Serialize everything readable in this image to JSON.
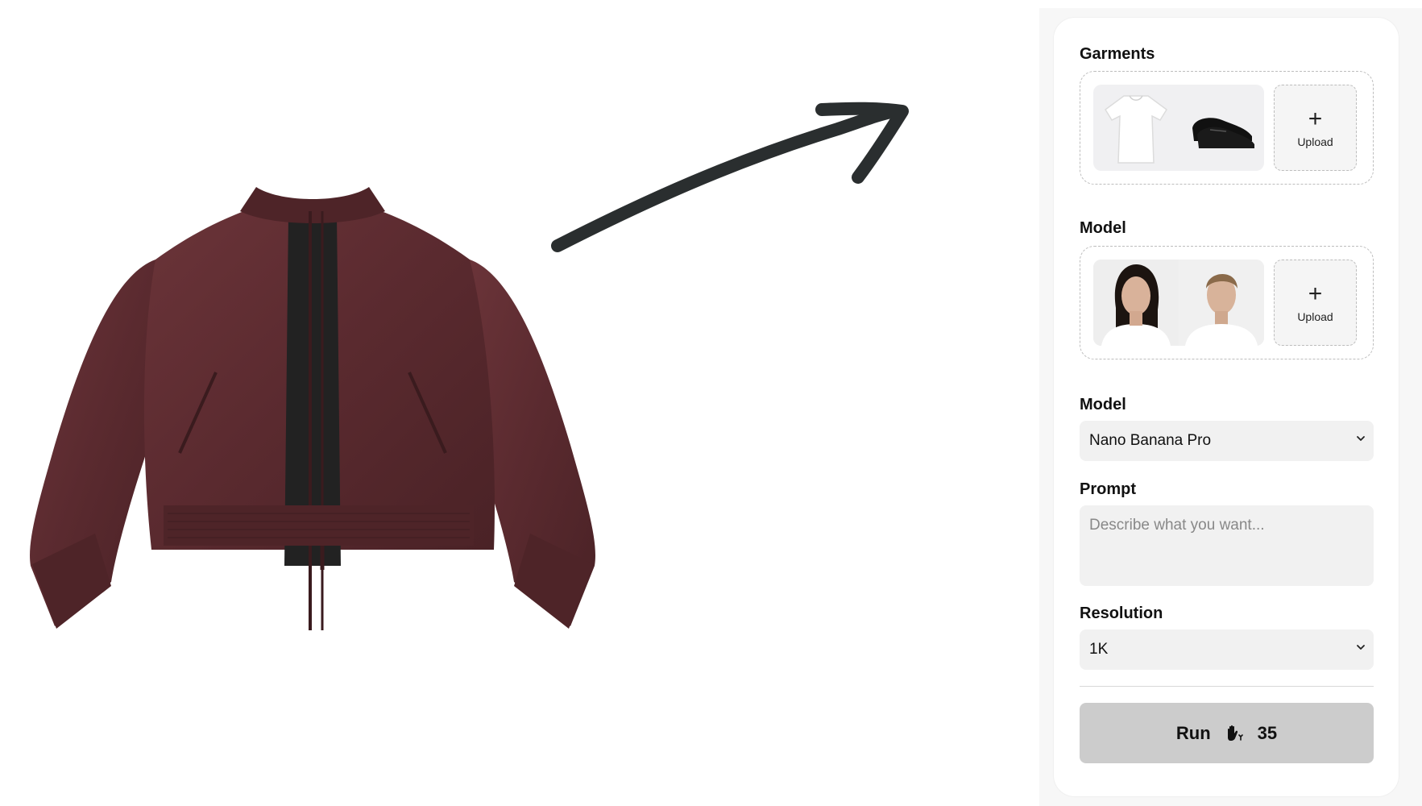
{
  "canvas": {
    "product_image": "bomber-jacket-image",
    "arrow": "hand-drawn-arrow"
  },
  "panel": {
    "garments": {
      "label": "Garments",
      "thumbnails": [
        "white-tshirt-image",
        "black-loafers-image"
      ],
      "upload_label": "Upload"
    },
    "model_images": {
      "label": "Model",
      "thumbnails": [
        "female-model-portrait",
        "male-model-portrait"
      ],
      "upload_label": "Upload"
    },
    "model_select": {
      "label": "Model",
      "value": "Nano Banana Pro"
    },
    "prompt": {
      "label": "Prompt",
      "value": "",
      "placeholder": "Describe what you want..."
    },
    "resolution": {
      "label": "Resolution",
      "value": "1K"
    },
    "run": {
      "label": "Run",
      "icon": "hand-coin-icon",
      "cost": "35"
    }
  },
  "colors": {
    "jacket": "#5a2c30",
    "arrow": "#2a2e2f",
    "run_bg": "#cccccc",
    "field_bg": "#f1f1f1"
  }
}
